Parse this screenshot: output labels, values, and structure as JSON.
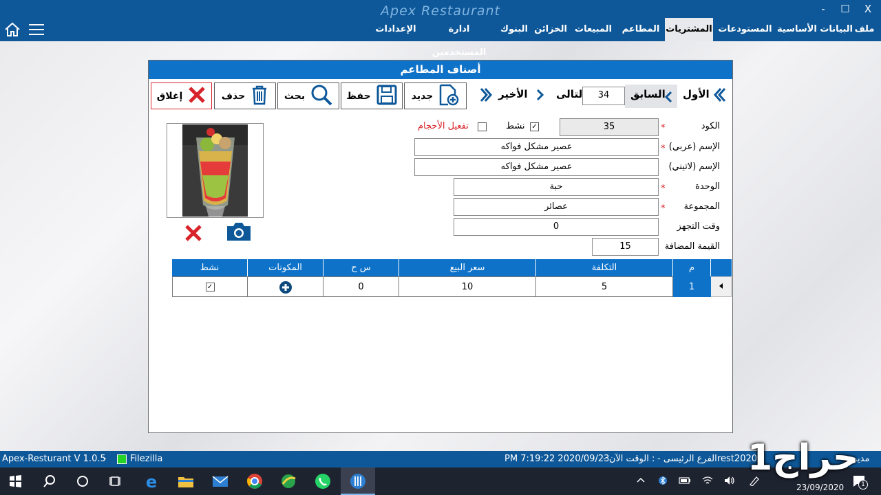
{
  "window": {
    "title": "Apex Restaurant",
    "minimize": "-",
    "maximize": "□",
    "close": "X"
  },
  "menu": {
    "items": [
      {
        "label": "ملف"
      },
      {
        "label": "البيانات الأساسية"
      },
      {
        "label": "المستودعات"
      },
      {
        "label": "المشتريات"
      },
      {
        "label": "المطاعم"
      },
      {
        "label": "المبيعات"
      },
      {
        "label": "الخزائن"
      },
      {
        "label": "البنوك"
      },
      {
        "label": "ادارة المستخدمين"
      },
      {
        "label": "الإعدادات"
      }
    ],
    "active_index": 3
  },
  "form": {
    "title": "أصناف المطاعم",
    "toolbar": {
      "close": "إغلاق",
      "delete": "حذف",
      "search": "بحث",
      "save": "حفظ",
      "new": "جديد"
    },
    "nav": {
      "last": "الأخير",
      "next": "التالى",
      "record": "34",
      "previous": "السابق",
      "first": "الأول"
    },
    "fields": {
      "code_label": "الكود",
      "code_value": "35",
      "active_label": "نشط",
      "active_checked": true,
      "sizes_label": "تفعيل الأحجام",
      "sizes_checked": false,
      "name_ar_label": "الإسم (عربي)",
      "name_ar_value": "عصير مشكل فواكه",
      "name_lat_label": "الإسم (لاتيني)",
      "name_lat_value": "عصير مشكل فواكه",
      "unit_label": "الوحدة",
      "unit_value": "حبة",
      "group_label": "المجموعة",
      "group_value": "عصائر",
      "prep_label": "وقت التجهز",
      "prep_value": "0",
      "vat_label": "القيمة المضافة",
      "vat_value": "15",
      "required_mark": "*"
    },
    "grid": {
      "headers": [
        "م",
        "التكلفة",
        "سعر البيع",
        "س ح",
        "المكونات",
        "نشط"
      ],
      "row": {
        "index": "1",
        "cost": "5",
        "price": "10",
        "sh": "0",
        "active_checked": true
      }
    }
  },
  "status": {
    "version": "Apex-Resturant V 1.0.5",
    "separator": "-",
    "filezilla": "Filezilla",
    "time": "PM 7:19:22 2020/09/23",
    "time_label": "- الوقت الآن :",
    "branch": "- الفرع الرئيسى",
    "db": "rest2020",
    "left_cut": "- مدير"
  },
  "taskbar": {
    "date": "23/09/2020",
    "notif_count": "1"
  },
  "watermark": "حراج1",
  "colors": {
    "titlebar": "#0e5899",
    "header_blue": "#0e72c9",
    "red": "#d8232a",
    "icon_blue": "#0e5899"
  }
}
